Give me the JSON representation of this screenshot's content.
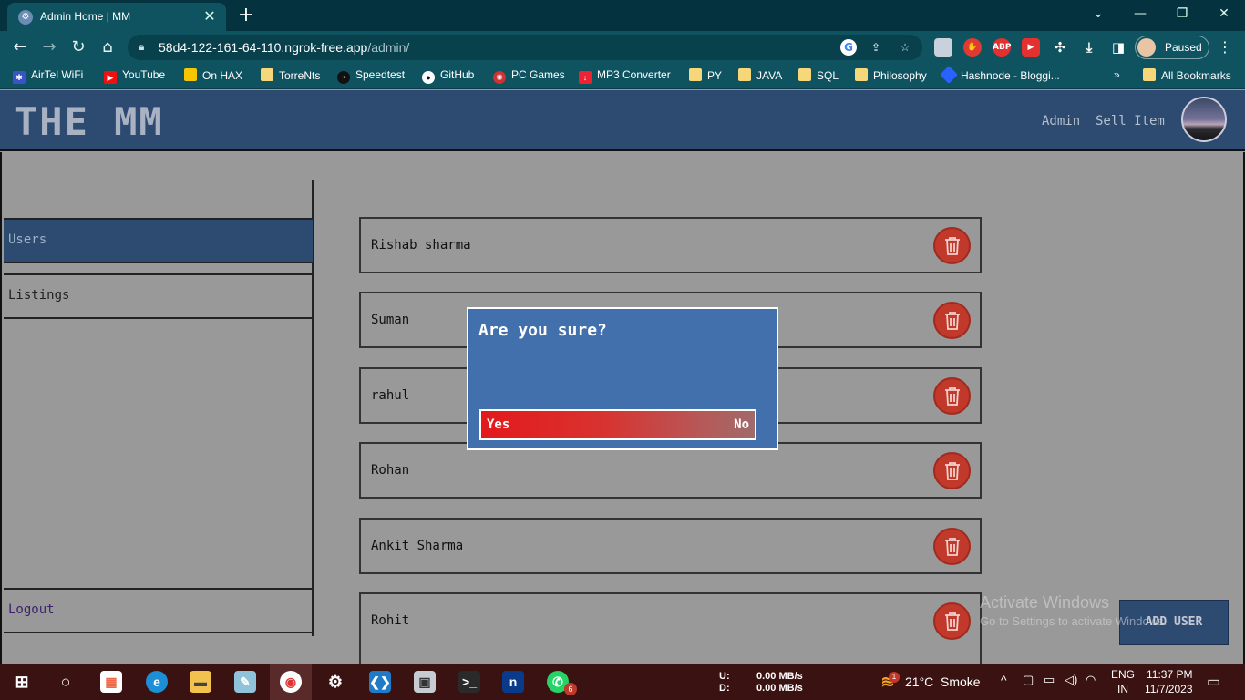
{
  "browser": {
    "tab_title": "Admin Home | MM",
    "new_tab": "+",
    "url_host": "58d4-122-161-64-110.ngrok-free.app",
    "url_path": "/admin/",
    "profile_status": "Paused",
    "ext_abp": "ABP",
    "bookmarks": [
      "AirTel WiFi",
      "YouTube",
      "On HAX",
      "TorreNts",
      "Speedtest",
      "GitHub",
      "PC Games",
      "MP3 Converter",
      "PY",
      "JAVA",
      "SQL",
      "Philosophy",
      "Hashnode - Bloggi...",
      "All Bookmarks"
    ],
    "bookmarks_overflow": "»"
  },
  "site": {
    "logo": "THE MM",
    "nav": {
      "admin": "Admin",
      "sell_item": "Sell Item"
    }
  },
  "sidebar": {
    "items": [
      {
        "label": "Users",
        "active": true
      },
      {
        "label": "Listings",
        "active": false
      }
    ],
    "logout": "Logout"
  },
  "users": [
    "Rishab sharma",
    "Suman",
    "rahul",
    "Rohan",
    "Ankit Sharma",
    "Rohit"
  ],
  "add_user_button": "ADD USER",
  "modal": {
    "question": "Are you sure?",
    "yes": "Yes",
    "no": "No"
  },
  "os": {
    "watermark_title": "Activate Windows",
    "watermark_sub": "Go to Settings to activate Windows.",
    "net_up_label": "U:",
    "net_down_label": "D:",
    "net_up": "0.00 MB/s",
    "net_down": "0.00 MB/s",
    "weather_temp": "21°C",
    "weather_desc": "Smoke",
    "weather_badge": "1",
    "lang": "ENG",
    "region": "IN",
    "time": "11:37 PM",
    "date": "11/7/2023",
    "whatsapp_badge": "6"
  },
  "colors": {
    "header_bg": "#2d4a71",
    "page_bg": "#999999",
    "modal_bg": "#4270ad",
    "trash_red": "#c0392b",
    "chrome_teal": "#0f5361"
  }
}
